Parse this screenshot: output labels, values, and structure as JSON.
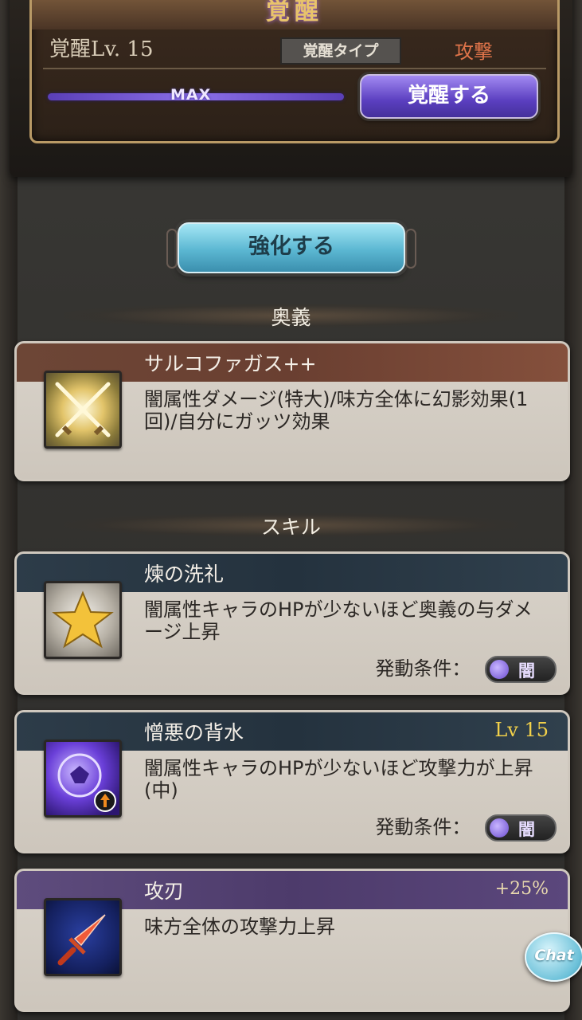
{
  "awakening": {
    "title": "覚醒",
    "level": "覚醒Lv. 15",
    "type_label": "覚醒タイプ",
    "type_value": "攻撃",
    "progress_label": "MAX",
    "progress_fraction": 1.0,
    "button_label": "覚醒する"
  },
  "enhance": {
    "button_label": "強化する"
  },
  "ougi": {
    "section_title": "奥義",
    "name": "サルコファガス++",
    "description": "闇属性ダメージ(特大)/味方全体に幻影効果(1回)/自分にガッツ効果",
    "icon": "crossed-swords-icon"
  },
  "skills": {
    "section_title": "スキル",
    "items": [
      {
        "name": "煉の洗礼",
        "description": "闇属性キャラのHPが少ないほど奥義の与ダメージ上昇",
        "condition_label": "発動条件：",
        "condition_element": "闇",
        "icon": "star-icon"
      },
      {
        "name": "憎悪の背水",
        "level": "Lv 15",
        "description": "闇属性キャラのHPが少ないほど攻撃力が上昇(中)",
        "condition_label": "発動条件：",
        "condition_element": "闇",
        "icon": "dark-emblem-icon"
      }
    ]
  },
  "support": {
    "name": "攻刃",
    "bonus": "+25%",
    "description": "味方全体の攻撃力上昇",
    "icon": "sword-icon"
  },
  "chat": {
    "label": "Chat"
  },
  "colors": {
    "awaken_purple": "#5b3fc0",
    "enhance_cyan": "#5bb7d2",
    "ougi_header": "#6a3f31",
    "skill_header": "#24323e",
    "support_header": "#4d3b6b",
    "attack_type": "#e0744a",
    "level_gold": "#f1d04a"
  }
}
